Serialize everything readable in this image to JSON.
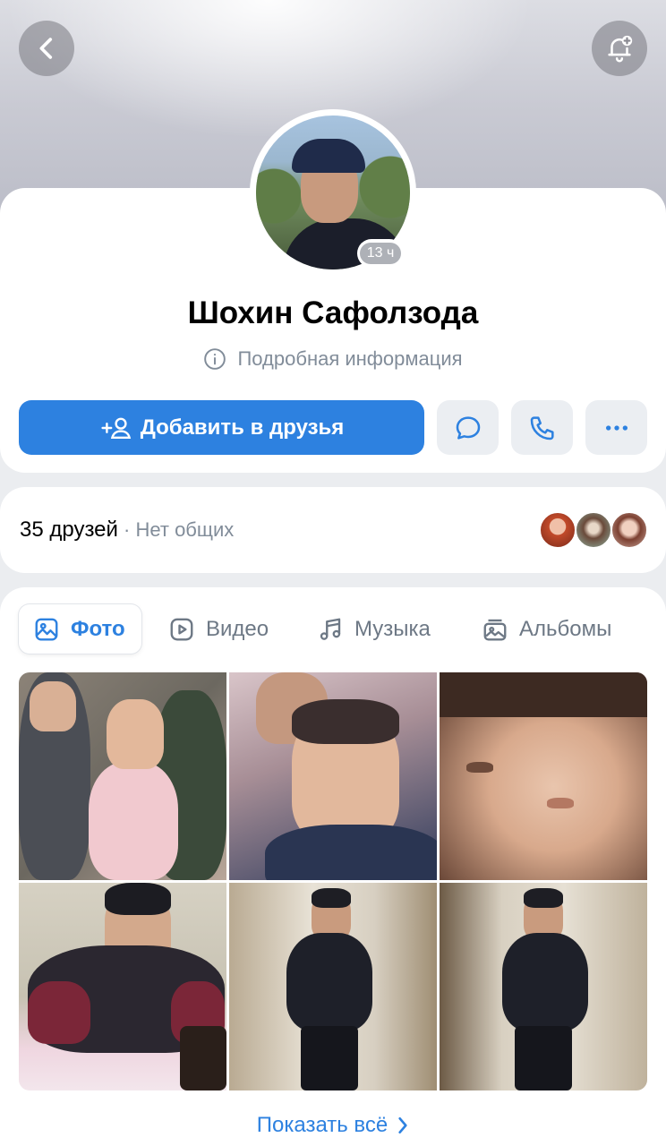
{
  "header": {
    "back_icon": "chevron-left-icon",
    "notify_icon": "bell-plus-icon"
  },
  "profile": {
    "name": "Шохин Сафолзода",
    "last_seen": "13 ч",
    "info_link": "Подробная информация",
    "info_icon": "info-circle-icon"
  },
  "actions": {
    "add_friend_label": "Добавить в друзья",
    "add_friend_icon": "add-user-icon",
    "message_icon": "message-icon",
    "call_icon": "phone-icon",
    "more_icon": "more-horizontal-icon"
  },
  "friends": {
    "count_label": "35 друзей",
    "mutual_label": " · Нет общих"
  },
  "tabs": [
    {
      "label": "Фото",
      "icon": "photo-icon",
      "active": true
    },
    {
      "label": "Видео",
      "icon": "video-icon",
      "active": false
    },
    {
      "label": "Музыка",
      "icon": "music-icon",
      "active": false
    },
    {
      "label": "Альбомы",
      "icon": "albums-icon",
      "active": false
    }
  ],
  "photos_count": 6,
  "show_all_label": "Показать всё",
  "colors": {
    "accent": "#2d81e0",
    "muted": "#818c99",
    "page_bg": "#ebedf0"
  }
}
